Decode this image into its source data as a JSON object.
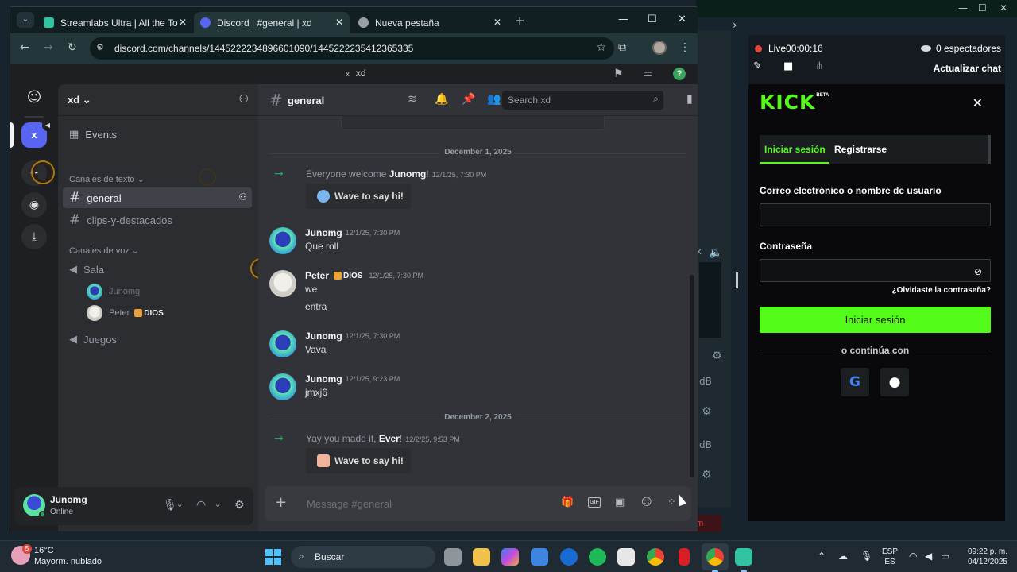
{
  "background_app": {
    "chat_panel": {
      "live_label": "Live",
      "live_time": "00:00:16",
      "viewers": "0 espectadores",
      "refresh_label": "Actualizar chat"
    },
    "side_labels": {
      "db1": "dB",
      "db2": "dB",
      "cam": "am"
    },
    "kick": {
      "logo_text": "KICK",
      "beta_text": "BETA",
      "tab_login": "Iniciar sesión",
      "tab_register": "Registrarse",
      "user_label": "Correo electrónico o nombre de usuario",
      "password_label": "Contraseña",
      "forgot": "¿Olvidaste la contraseña?",
      "login_button": "Iniciar sesión",
      "or_continue": "o continúa con",
      "social_google": "G",
      "brand_color": "#53fc18"
    }
  },
  "browser": {
    "tabs": [
      {
        "title": "Streamlabs Ultra | All the Tools",
        "icon": "streamlabs-icon",
        "color": "#31c3a2"
      },
      {
        "title": "Discord | #general | xd",
        "icon": "discord-icon",
        "color": "#5865f2",
        "active": true
      },
      {
        "title": "Nueva pestaña",
        "icon": "chrome-icon",
        "color": "#9aa0a6"
      }
    ],
    "url": "discord.com/channels/1445222234896601090/1445222235412365335"
  },
  "discord": {
    "window_title": "xd",
    "server_badge": "x",
    "server_name": "xd",
    "events_label": "Events",
    "text_category": "Canales de texto",
    "voice_category": "Canales de voz",
    "text_channels": [
      "general",
      "clips-y-destacados"
    ],
    "voice_channels": [
      "Sala",
      "Juegos"
    ],
    "voice_users": [
      {
        "name": "Junomg"
      },
      {
        "name": "Peter",
        "role": "DIOS"
      }
    ],
    "current_channel": "general",
    "search_placeholder": "Search xd",
    "messages": {
      "divider1": "December 1, 2025",
      "sys1_pre": "Everyone welcome ",
      "sys1_user": "Junomg",
      "sys1_post": "!",
      "sys1_time": "12/1/25, 7:30 PM",
      "wave_label": "Wave to say hi!",
      "m1_author": "Junomg",
      "m1_time": "12/1/25, 7:30 PM",
      "m1_text": "Que roll",
      "m2_author": "Peter",
      "m2_role": "DIOS",
      "m2_time": "12/1/25, 7:30 PM",
      "m2_text1": "we",
      "m2_text2": "entra",
      "m3_author": "Junomg",
      "m3_time": "12/1/25, 7:30 PM",
      "m3_text": "Vava",
      "m4_author": "Junomg",
      "m4_time": "12/1/25, 9:23 PM",
      "m4_text": "jmxj6",
      "divider2": "December 2, 2025",
      "sys2_pre": "Yay you made it, ",
      "sys2_user": "Ever",
      "sys2_post": "!",
      "sys2_time": "12/2/25, 9:53 PM"
    },
    "composer_placeholder": "Message #general",
    "composer_gif": "GIF",
    "user": {
      "name": "Junomg",
      "status": "Online"
    }
  },
  "taskbar": {
    "weather_badge": "5",
    "temperature": "16°C",
    "weather_desc": "Mayorm. nublado",
    "search_label": "Buscar",
    "lang_line1": "ESP",
    "lang_line2": "ES",
    "time": "09:22 p. m.",
    "date": "04/12/2025"
  }
}
